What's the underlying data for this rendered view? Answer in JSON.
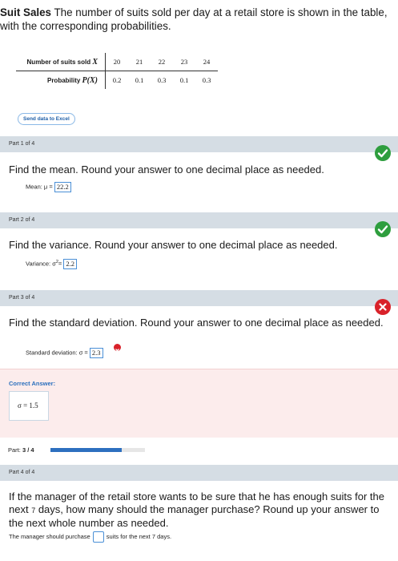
{
  "intro": {
    "title": "Suit Sales",
    "text": " The number of suits sold per day at a retail store is shown in the table, with the corresponding probabilities."
  },
  "table": {
    "row1_label": "Number of suits sold ",
    "row1_var": "X",
    "row2_label": "Probability ",
    "row2_var": "P(X)",
    "x_values": [
      "20",
      "21",
      "22",
      "23",
      "24"
    ],
    "p_values": [
      "0.2",
      "0.1",
      "0.3",
      "0.1",
      "0.3"
    ]
  },
  "send_excel": "Send data to Excel",
  "parts": [
    {
      "label": "Part 1 of 4",
      "question": "Find the mean. Round your answer to one decimal place as needed.",
      "answer_prefix": "Mean: μ =",
      "answer": "22.2",
      "status": "correct"
    },
    {
      "label": "Part 2 of 4",
      "question": "Find the variance. Round your answer to one decimal place as needed.",
      "answer_prefix": "Variance: σ",
      "answer_sup": "2",
      "answer_eq": "=",
      "answer": "2.2",
      "status": "correct"
    },
    {
      "label": "Part 3 of 4",
      "question": "Find the standard deviation. Round your answer to one decimal place as needed.",
      "answer_prefix": "Standard deviation: σ =",
      "answer": "2.3",
      "status": "incorrect",
      "correct_title": "Correct Answer:",
      "correct_value": "σ = 1.5"
    },
    {
      "label": "Part 4 of 4",
      "question_a": "If the manager of the retail store wants to be sure that he has enough suits for the next ",
      "question_small": "7",
      "question_b": " days, how many should the manager purchase? Round up your answer to the next whole number as needed.",
      "sentence_a": "The manager should purchase",
      "sentence_b": "suits for the next 7 days."
    }
  ],
  "progress": {
    "label": "Part:",
    "value": "3 / 4",
    "fraction": 0.75
  },
  "colors": {
    "bar": "#d5dde4",
    "correct": "#2e9e3e",
    "incorrect": "#d9222a",
    "accent": "#2d6fbf"
  }
}
